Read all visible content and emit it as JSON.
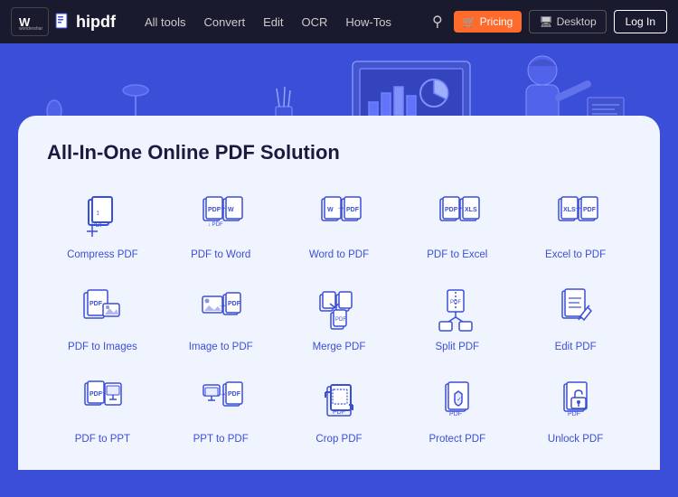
{
  "navbar": {
    "logo_ws_text": "W",
    "logo_hipdf_text": "hipdf",
    "nav_items": [
      "All tools",
      "Convert",
      "Edit",
      "OCR",
      "How-Tos"
    ],
    "pricing_label": "Pricing",
    "desktop_label": "Desktop",
    "login_label": "Log In"
  },
  "hero": {
    "tagline": "All-In-One Online PDF Solution"
  },
  "tools": [
    {
      "id": "compress-pdf",
      "label": "Compress PDF",
      "icon": "compress"
    },
    {
      "id": "pdf-to-word",
      "label": "PDF to Word",
      "icon": "pdf-to-word"
    },
    {
      "id": "word-to-pdf",
      "label": "Word to PDF",
      "icon": "word-to-pdf"
    },
    {
      "id": "pdf-to-excel",
      "label": "PDF to Excel",
      "icon": "pdf-to-excel"
    },
    {
      "id": "excel-to-pdf",
      "label": "Excel to PDF",
      "icon": "excel-to-pdf"
    },
    {
      "id": "pdf-to-images",
      "label": "PDF to Images",
      "icon": "pdf-to-images"
    },
    {
      "id": "image-to-pdf",
      "label": "Image to PDF",
      "icon": "image-to-pdf"
    },
    {
      "id": "merge-pdf",
      "label": "Merge PDF",
      "icon": "merge-pdf"
    },
    {
      "id": "split-pdf",
      "label": "Split PDF",
      "icon": "split-pdf"
    },
    {
      "id": "edit-pdf",
      "label": "Edit PDF",
      "icon": "edit-pdf"
    },
    {
      "id": "pdf-to-ppt",
      "label": "PDF to PPT",
      "icon": "pdf-to-ppt"
    },
    {
      "id": "ppt-to-pdf",
      "label": "PPT to PDF",
      "icon": "ppt-to-pdf"
    },
    {
      "id": "crop-pdf",
      "label": "Crop PDF",
      "icon": "crop-pdf"
    },
    {
      "id": "protect-pdf",
      "label": "Protect PDF",
      "icon": "protect-pdf"
    },
    {
      "id": "unlock-pdf",
      "label": "Unlock PDF",
      "icon": "unlock-pdf"
    }
  ]
}
